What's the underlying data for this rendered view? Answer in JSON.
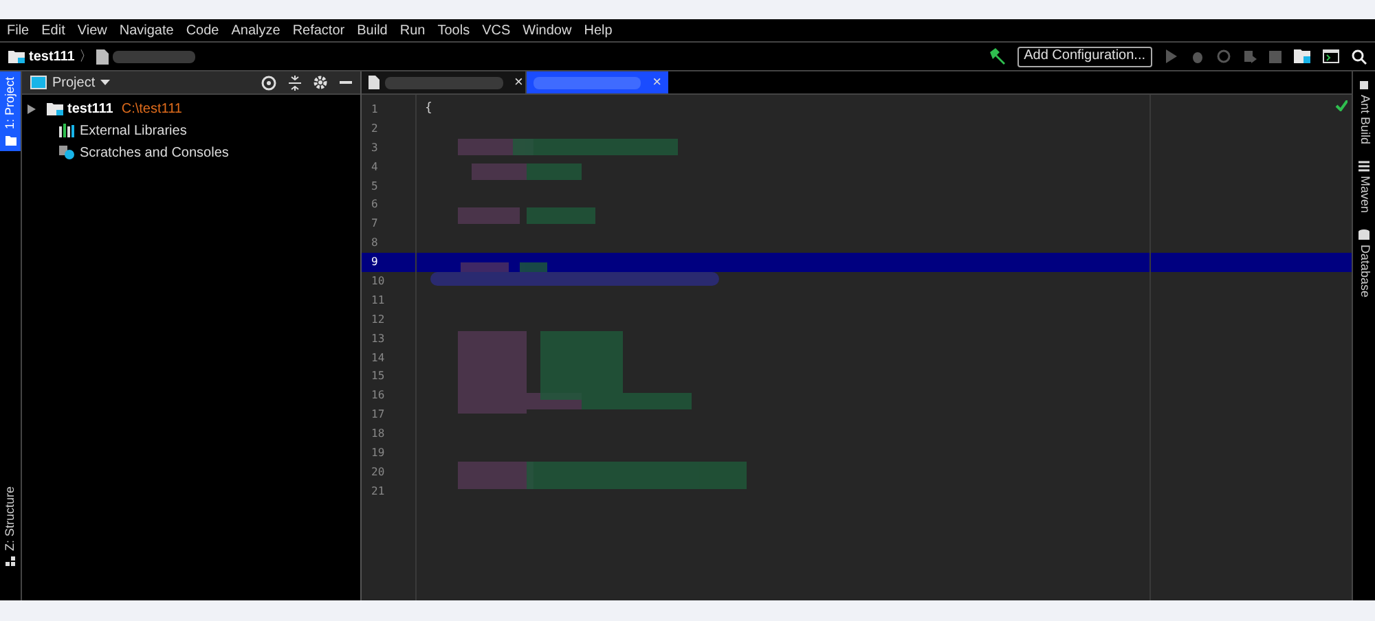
{
  "menu": [
    "File",
    "Edit",
    "View",
    "Navigate",
    "Code",
    "Analyze",
    "Refactor",
    "Build",
    "Run",
    "Tools",
    "VCS",
    "Window",
    "Help"
  ],
  "breadcrumb": {
    "project": "test111",
    "separator": "〉"
  },
  "toolbar": {
    "config_button": "Add Configuration..."
  },
  "left_stripe": [
    {
      "label": "1: Project",
      "selected": true
    },
    {
      "label": "Z: Structure",
      "selected": false
    }
  ],
  "project_panel": {
    "title": "Project",
    "tree": [
      {
        "label": "test111",
        "path": "C:\\test111",
        "kind": "module",
        "expanded": false
      },
      {
        "label": "External Libraries",
        "kind": "libraries"
      },
      {
        "label": "Scratches and Consoles",
        "kind": "scratches"
      }
    ]
  },
  "editor_tabs": [
    {
      "selected": false,
      "close": "×"
    },
    {
      "selected": true,
      "close": "×"
    }
  ],
  "editor": {
    "first_line": "{",
    "lines": [
      {
        "number": "1",
        "current": false
      },
      {
        "number": "2",
        "current": false
      },
      {
        "number": "3",
        "current": false
      },
      {
        "number": "4",
        "current": false
      },
      {
        "number": "5",
        "current": false
      },
      {
        "number": "6",
        "current": false
      },
      {
        "number": "7",
        "current": false
      },
      {
        "number": "8",
        "current": false
      },
      {
        "number": "9",
        "current": true
      },
      {
        "number": "10",
        "current": false
      },
      {
        "number": "11",
        "current": false
      },
      {
        "number": "12",
        "current": false
      },
      {
        "number": "13",
        "current": false
      },
      {
        "number": "14",
        "current": false
      },
      {
        "number": "15",
        "current": false
      },
      {
        "number": "16",
        "current": false
      },
      {
        "number": "17",
        "current": false
      },
      {
        "number": "18",
        "current": false
      },
      {
        "number": "19",
        "current": false
      },
      {
        "number": "20",
        "current": false
      },
      {
        "number": "21",
        "current": false
      }
    ]
  },
  "right_stripe": [
    "Ant Build",
    "Maven",
    "Database"
  ]
}
